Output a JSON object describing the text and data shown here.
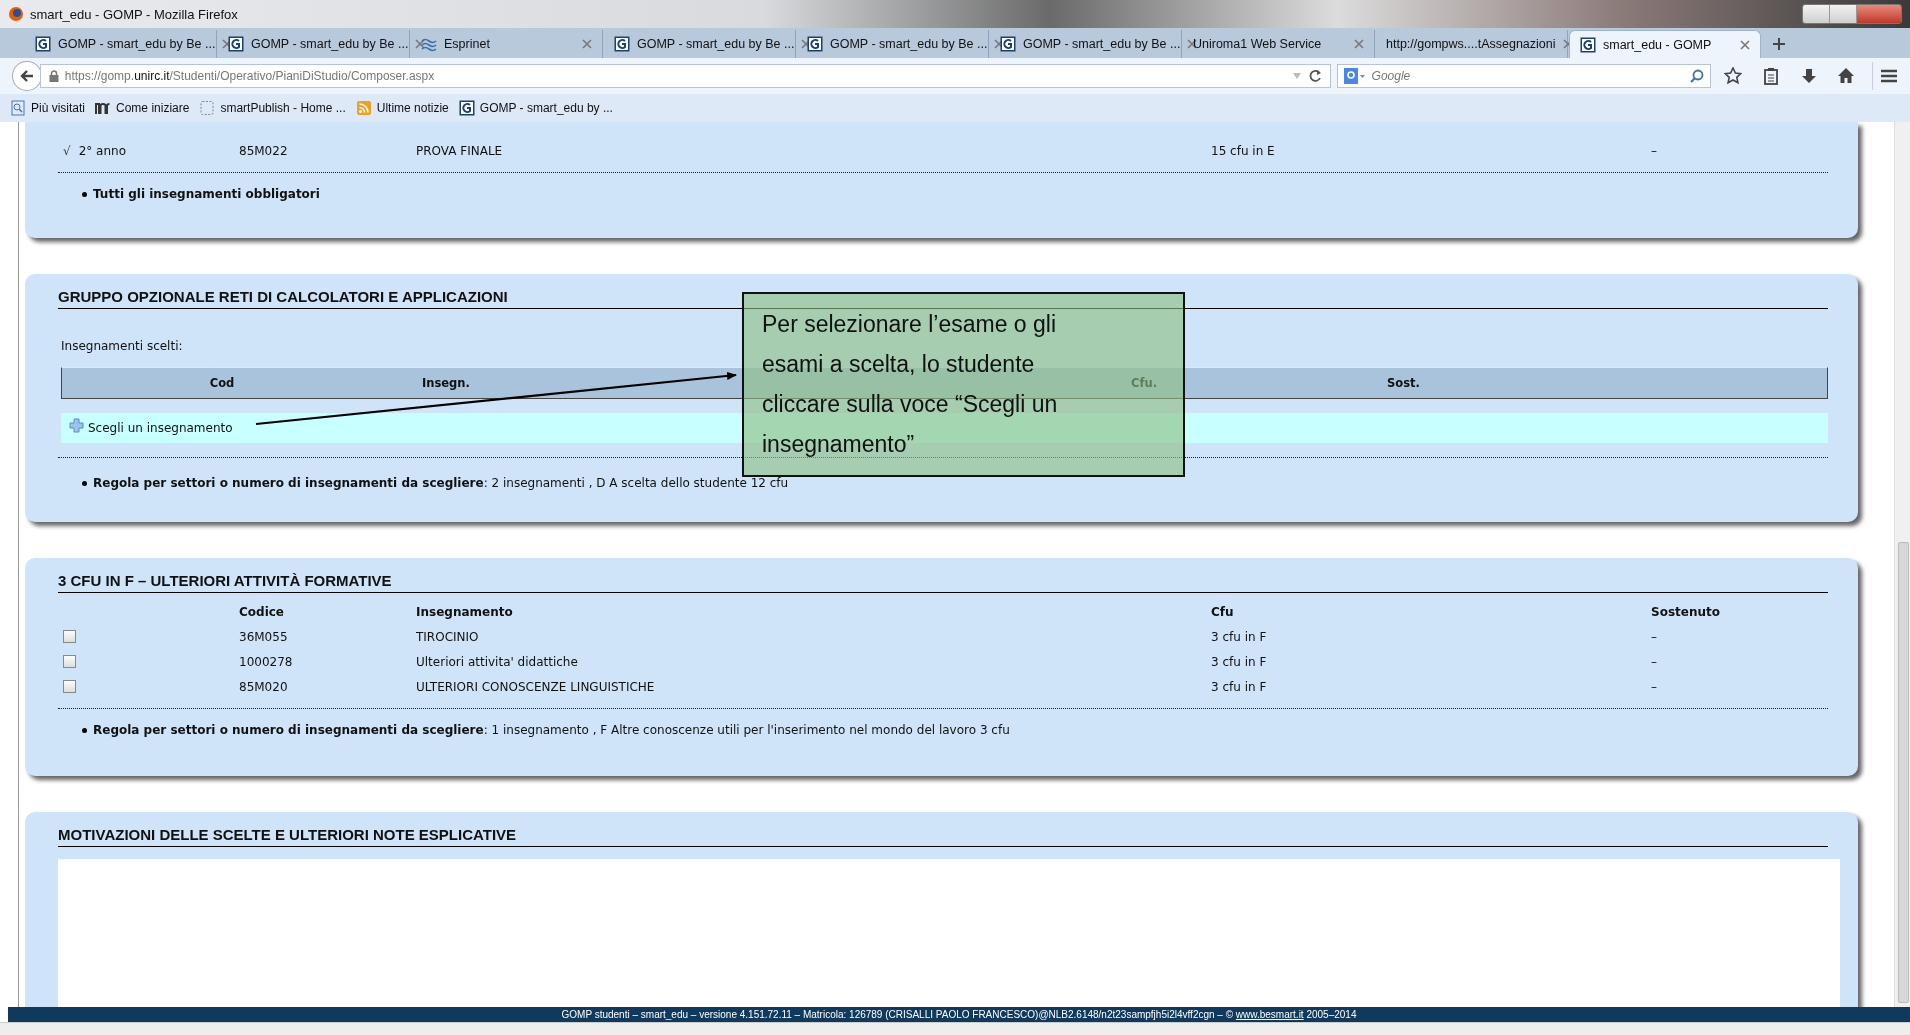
{
  "window": {
    "title": "smart_edu - GOMP - Mozilla Firefox"
  },
  "tabs": [
    {
      "label": "GOMP - smart_edu by Be ...",
      "selected": false
    },
    {
      "label": "GOMP - smart_edu by Be ...",
      "selected": false
    },
    {
      "label": "Esprinet",
      "selected": false
    },
    {
      "label": "GOMP - smart_edu by Be ...",
      "selected": false
    },
    {
      "label": "GOMP - smart_edu by Be ...",
      "selected": false
    },
    {
      "label": "GOMP - smart_edu by Be ...",
      "selected": false
    },
    {
      "label": "Uniroma1 Web Service",
      "selected": false
    },
    {
      "label": "http://gompws....tAssegnazioni",
      "selected": false
    },
    {
      "label": "smart_edu - GOMP",
      "selected": true
    }
  ],
  "address_bar": {
    "url_prefix": "https://gomp.",
    "url_domain": "unirc.it",
    "url_path": "/Studenti/Operativo/PianiDiStudio/Composer.aspx"
  },
  "search": {
    "placeholder": "Google"
  },
  "bookmarks": [
    {
      "label": "Più visitati"
    },
    {
      "label": "Come iniziare"
    },
    {
      "label": "smartPublish - Home ..."
    },
    {
      "label": "Ultime notizie"
    },
    {
      "label": "GOMP - smart_edu by ..."
    }
  ],
  "sections": [
    {
      "kind": "courses",
      "rows": [
        {
          "kind": "fixed",
          "mark": "√",
          "year": "2° anno",
          "code": "85M022",
          "name": "PROVA FINALE",
          "cfu": "15 cfu in E",
          "done": "–"
        }
      ],
      "note": "**Tutti gli insegnamenti obbligatori**"
    },
    {
      "kind": "choice",
      "title": "GRUPPO OPZIONALE RETI DI CALCOLATORI E APPLICAZIONI",
      "label": "Insegnamenti scelti:",
      "columns": [
        "Cod",
        "Insegn.",
        "Cfu.",
        "Sost."
      ],
      "action": "Scegli un insegnamento",
      "note": "**Regola per settori o numero di insegnamenti da scegliere**: 2 insegnamenti , D A scelta dello studente 12 cfu"
    },
    {
      "kind": "courses",
      "title": "3 CFU IN F – ULTERIORI ATTIVITÀ FORMATIVE",
      "columns": [
        "Codice",
        "Insegnamento",
        "Cfu",
        "Sostenuto"
      ],
      "rows": [
        {
          "kind": "checkbox",
          "checked": false,
          "code": "36M055",
          "name": "TIROCINIO",
          "cfu": "3 cfu in F",
          "done": "–"
        },
        {
          "kind": "checkbox",
          "checked": false,
          "code": "1000278",
          "name": "Ulteriori attivita' didattiche",
          "cfu": "3 cfu in F",
          "done": "–"
        },
        {
          "kind": "checkbox",
          "checked": false,
          "code": "85M020",
          "name": "ULTERIORI CONOSCENZE LINGUISTICHE",
          "cfu": "3 cfu in F",
          "done": "–"
        }
      ],
      "note": "**Regola per settori o numero di insegnamenti da scegliere**: 1 insegnamento , F Altre conoscenze utili per l'inserimento nel mondo del lavoro 3 cfu"
    },
    {
      "kind": "notes",
      "title": "MOTIVAZIONI DELLE SCELTE E ULTERIORI NOTE ESPLICATIVE"
    }
  ],
  "callout": {
    "text": "Per selezionare l’esame o gli esami a scelta, lo studente cliccare sulla voce “Scegli un insegnamento”"
  },
  "footer": {
    "text": "GOMP studenti – smart_edu – versione 4.151.72.11 – Matricola: 126789 (CRISALLI PAOLO FRANCESCO)@NLB2.6148/n2t23sampfjh5i2l4vff2cgn – © ",
    "link": "www.besmart.it",
    "suffix": " 2005–2014"
  }
}
